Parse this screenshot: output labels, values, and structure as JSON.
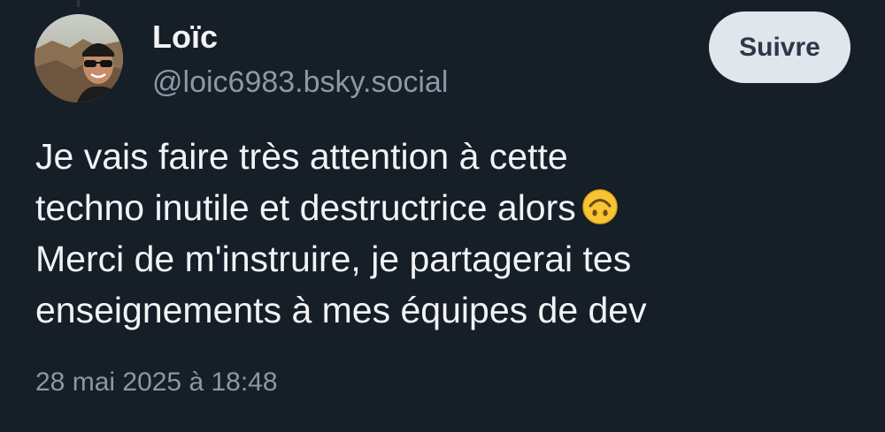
{
  "author": {
    "display_name": "Loïc",
    "handle": "@loic6983.bsky.social",
    "avatar": "avatar-photo"
  },
  "follow_button": {
    "label": "Suivre"
  },
  "post": {
    "lines": [
      "Je vais faire très attention à cette",
      "techno inutile et destructrice alors",
      "Merci de m'instruire, je partagerai tes",
      "enseignements à mes équipes de dev"
    ],
    "emoji": "upside-down-face-icon",
    "timestamp": "28 mai 2025 à 18:48"
  },
  "colors": {
    "background": "#161e27",
    "text": "#f1f3f5",
    "secondary_text": "#8b98a5",
    "button_bg": "#dfe6ec",
    "button_text": "#2c3846"
  }
}
